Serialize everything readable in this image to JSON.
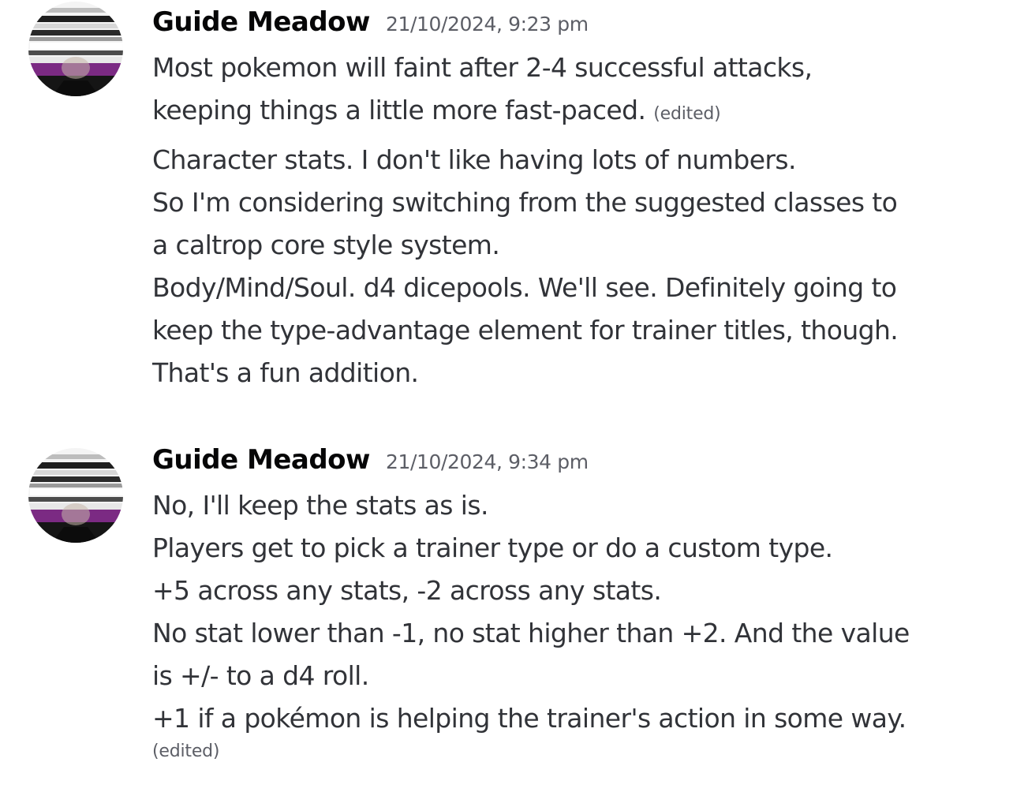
{
  "messages": [
    {
      "username": "Guide Meadow",
      "timestamp": "21/10/2024, 9:23 pm",
      "avatar_icon": "user-avatar",
      "blocks": [
        {
          "lines": [
            "Most pokemon will faint after 2-4 successful attacks,",
            "keeping things a little more fast-paced."
          ],
          "edited": "(edited)"
        },
        {
          "lines": [
            "Character stats. I don't like having lots of numbers.",
            "So I'm considering switching from the suggested classes to",
            "a caltrop core style system.",
            "Body/Mind/Soul. d4 dicepools. We'll see. Definitely going to",
            "keep the type-advantage element for trainer titles, though.",
            "That's a fun addition."
          ]
        }
      ]
    },
    {
      "username": "Guide Meadow",
      "timestamp": "21/10/2024, 9:34 pm",
      "avatar_icon": "user-avatar",
      "blocks": [
        {
          "lines": [
            "No, I'll keep the stats as is.",
            "Players get to pick a trainer type or do a custom type.",
            "+5 across any stats, -2 across any stats.",
            "No stat lower than -1, no stat higher than +2. And the value",
            "is +/- to a d4 roll.",
            "+1 if a pokémon is helping the trainer's action in some way."
          ],
          "edited": "(edited)"
        }
      ]
    }
  ],
  "colors": {
    "username": "#060607",
    "text": "#313338",
    "muted": "#5c5e66",
    "avatar_flag": [
      "#000000",
      "#a3a3a3",
      "#ffffff",
      "#800080"
    ]
  }
}
